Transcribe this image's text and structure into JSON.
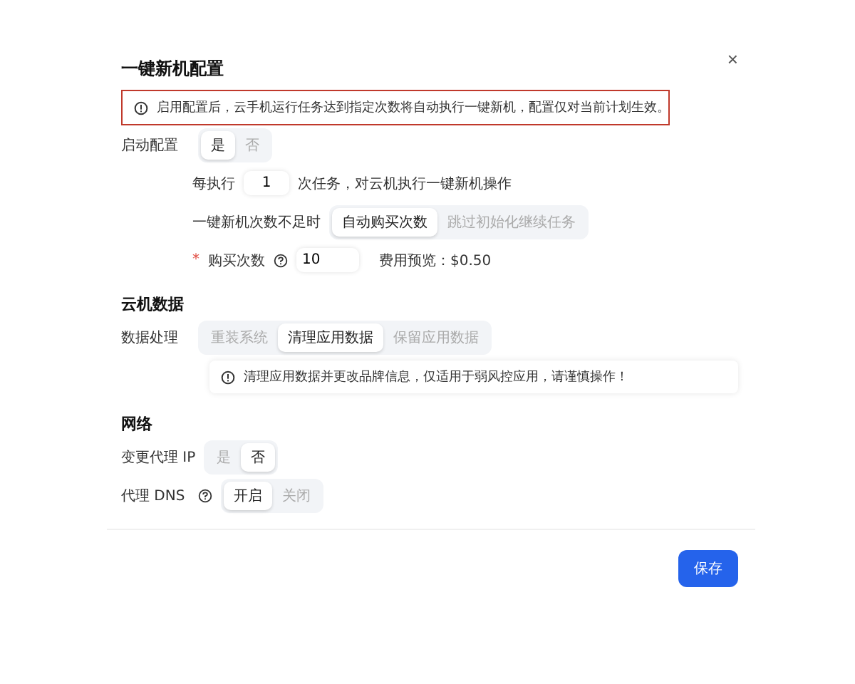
{
  "dialog": {
    "title": "一键新机配置",
    "close": "×",
    "notice": "启用配置后，云手机运行任务达到指定次数将自动执行一键新机，配置仅对当前计划生效。",
    "sections": [
      {
        "rows": [
          {
            "kind": "segmented",
            "label": "启动配置",
            "options": [
              {
                "label": "是",
                "selected": true
              },
              {
                "label": "否",
                "selected": false
              }
            ]
          },
          {
            "kind": "count",
            "prefix": "每执行",
            "value": "1",
            "suffix": "次任务，对云机执行一键新机操作"
          },
          {
            "kind": "sub-segmented",
            "label": "一键新机次数不足时",
            "options": [
              {
                "label": "自动购买次数",
                "selected": true
              },
              {
                "label": "跳过初始化继续任务",
                "selected": false
              }
            ]
          },
          {
            "kind": "purchase",
            "required_mark": "*",
            "label": "购买次数",
            "value": "10",
            "cost": "费用预览：$0.50"
          }
        ]
      },
      {
        "title": "云机数据",
        "rows": [
          {
            "kind": "segmented",
            "label": "数据处理",
            "options": [
              {
                "label": "重装系统",
                "selected": false
              },
              {
                "label": "清理应用数据",
                "selected": true
              },
              {
                "label": "保留应用数据",
                "selected": false
              }
            ]
          },
          {
            "kind": "note",
            "text": "清理应用数据并更改品牌信息，仅适用于弱风控应用，请谨慎操作！"
          }
        ]
      },
      {
        "title": "网络",
        "rows": [
          {
            "kind": "segmented",
            "label": "变更代理 IP",
            "options": [
              {
                "label": "是",
                "selected": false
              },
              {
                "label": "否",
                "selected": true
              }
            ]
          },
          {
            "kind": "segmented",
            "label": "代理 DNS",
            "help": true,
            "options": [
              {
                "label": "开启",
                "selected": true
              },
              {
                "label": "关闭",
                "selected": false
              }
            ]
          }
        ]
      }
    ],
    "save": "保存"
  }
}
